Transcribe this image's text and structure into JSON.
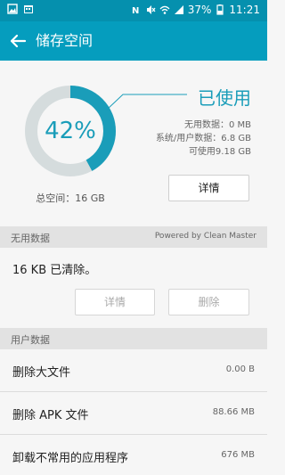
{
  "status_bar": {
    "battery": "37%",
    "time": "11:21"
  },
  "app_bar": {
    "title": "储存空间"
  },
  "summary": {
    "used_label": "已使用",
    "percent": "42%",
    "used_fraction": 0.42,
    "unused_data_line": "无用数据：0 MB",
    "system_user_line": "系统/用户数据：6.8 GB",
    "available_line": "可使用9.18 GB",
    "total_line": "总空间：16 GB",
    "details_button": "详情"
  },
  "junk_section": {
    "header": "无用数据",
    "powered_by": "Powered by Clean Master",
    "cleared_text": "16 KB 已清除。",
    "details_button": "详情",
    "delete_button": "删除"
  },
  "user_data_section": {
    "header": "用户数据",
    "items": [
      {
        "label": "删除大文件",
        "value": "0.00 B"
      },
      {
        "label": "删除 APK 文件",
        "value": "88.66 MB"
      },
      {
        "label": "卸载不常用的应用程序",
        "value": "676 MB"
      }
    ]
  },
  "colors": {
    "accent": "#1a9db9",
    "app_bar": "#059dbe",
    "status_bar": "#0590ae",
    "donut_track": "#d5dcdd"
  },
  "icons": {
    "back": "arrow-left-icon"
  }
}
